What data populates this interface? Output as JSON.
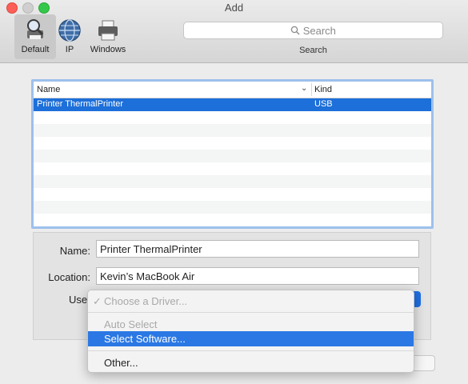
{
  "window": {
    "title": "Add"
  },
  "toolbar": {
    "items": [
      {
        "label": "Default",
        "icon": "default-printer-icon",
        "selected": true
      },
      {
        "label": "IP",
        "icon": "globe-icon"
      },
      {
        "label": "Windows",
        "icon": "windows-printer-icon"
      }
    ],
    "search": {
      "placeholder": "Search",
      "caption": "Search"
    }
  },
  "printer_list": {
    "columns": [
      "Name",
      "Kind"
    ],
    "rows": [
      {
        "name": "Printer ThermalPrinter",
        "kind": "USB",
        "selected": true
      }
    ]
  },
  "form": {
    "name_label": "Name:",
    "name_value": "Printer ThermalPrinter",
    "location_label": "Location:",
    "location_value": "Kevin’s MacBook Air",
    "use_label": "Use"
  },
  "driver_menu": {
    "items": [
      {
        "label": "Choose a Driver...",
        "checked": true,
        "disabled": true
      },
      {
        "label": "Auto Select",
        "disabled": true
      },
      {
        "label": "Select Software...",
        "highlighted": true
      },
      {
        "label": "Other..."
      }
    ],
    "check_glyph": "✓"
  },
  "colors": {
    "selection": "#1d6fd9",
    "menu_highlight": "#2b78e4"
  }
}
